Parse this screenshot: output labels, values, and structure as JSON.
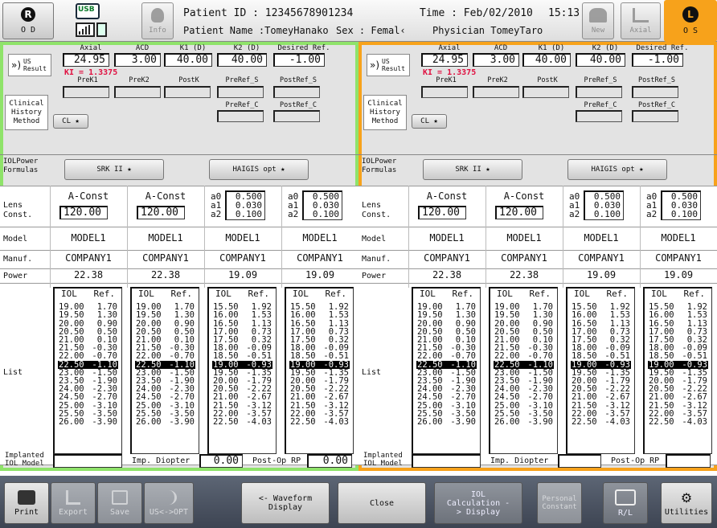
{
  "top": {
    "od": "O D",
    "os": "O S",
    "info_label": "Info",
    "new_label": "New",
    "axial_label": "Axial",
    "patient_id": "Patient ID : 12345678901234",
    "patient_name": "Patient Name :TomeyHanako",
    "sex": "Sex : Femal‹",
    "time": "Time : Feb/02/2010",
    "clock": "15:13",
    "physician": "Physician TomeyTaro",
    "usb": "USB"
  },
  "labels": {
    "us_result": "US Result",
    "axial": "Axial",
    "acd": "ACD",
    "k1": "K1 (D)",
    "k2": "K2 (D)",
    "desired": "Desired Ref.",
    "ki": "KI = 1.3375",
    "prek1": "PreK1",
    "prek2": "PreK2",
    "postk": "PostK",
    "preref_s": "PreRef_S",
    "postref_s": "PostRef_S",
    "preref_c": "PreRef_C",
    "postref_c": "PostRef_C",
    "clinical": "Clinical History Method",
    "cl": "CL ★",
    "iol_formulas": "IOLPower Formulas",
    "lens_const": "Lens Const.",
    "model": "Model",
    "manuf": "Manuf.",
    "power": "Power",
    "list": "List",
    "iol_col": "IOL",
    "ref_col": "Ref.",
    "a_const": "A-Const",
    "a0": "a0",
    "a1": "a1",
    "a2": "a2",
    "implanted": "Implanted IOL Model",
    "imp_diopter": "Imp. Diopter",
    "post_op": "Post-Op RP"
  },
  "values": {
    "axial": "24.95",
    "acd": "3.00",
    "k1": "40.00",
    "k2": "40.00",
    "desired": "-1.00",
    "formula1": "SRK II ★",
    "formula2": "HAIGIS opt ★",
    "aconst": "120.00",
    "a0": "0.500",
    "a1": "0.030",
    "a2": "0.100",
    "model": "MODEL1",
    "manuf": "COMPANY1",
    "power_srk": "22.38",
    "power_haigis": "19.09",
    "imp_diopter_val": "0.00",
    "post_op_val": "0.00"
  },
  "lists": {
    "srk": [
      [
        "19.00",
        "1.70"
      ],
      [
        "19.50",
        "1.30"
      ],
      [
        "20.00",
        "0.90"
      ],
      [
        "20.50",
        "0.50"
      ],
      [
        "21.00",
        "0.10"
      ],
      [
        "21.50",
        "-0.30"
      ],
      [
        "22.00",
        "-0.70"
      ],
      [
        "22.50",
        "-1.10"
      ],
      [
        "23.00",
        "-1.50"
      ],
      [
        "23.50",
        "-1.90"
      ],
      [
        "24.00",
        "-2.30"
      ],
      [
        "24.50",
        "-2.70"
      ],
      [
        "25.00",
        "-3.10"
      ],
      [
        "25.50",
        "-3.50"
      ],
      [
        "26.00",
        "-3.90"
      ]
    ],
    "haigis": [
      [
        "15.50",
        "1.92"
      ],
      [
        "16.00",
        "1.53"
      ],
      [
        "16.50",
        "1.13"
      ],
      [
        "17.00",
        "0.73"
      ],
      [
        "17.50",
        "0.32"
      ],
      [
        "18.00",
        "-0.09"
      ],
      [
        "18.50",
        "-0.51"
      ],
      [
        "19.00",
        "-0.93"
      ],
      [
        "19.50",
        "-1.35"
      ],
      [
        "20.00",
        "-1.79"
      ],
      [
        "20.50",
        "-2.22"
      ],
      [
        "21.00",
        "-2.67"
      ],
      [
        "21.50",
        "-3.12"
      ],
      [
        "22.00",
        "-3.57"
      ],
      [
        "22.50",
        "-4.03"
      ]
    ],
    "selected_index": 7
  },
  "bottom": {
    "print": "Print",
    "export": "Export",
    "save": "Save",
    "us_opt": "US<->OPT",
    "waveform": "<- Waveform Display",
    "close": "Close",
    "iol_calc": "IOL Calculation -> Display",
    "personal": "Personal Constant",
    "rl": "R/L",
    "utilities": "Utilities"
  },
  "colors": {
    "green": "#8fe36a",
    "orange": "#f7a21b",
    "header_bg": "#e6e6e6"
  }
}
